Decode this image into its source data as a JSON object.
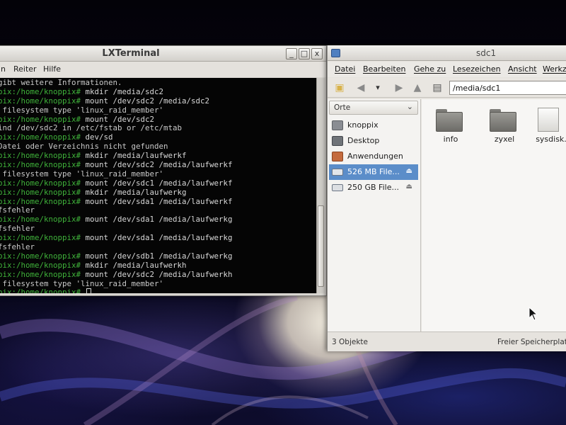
{
  "terminal": {
    "title": "LXTerminal",
    "menu": [
      "n",
      "Reiter",
      "Hilfe"
    ],
    "window_buttons": [
      "_",
      "□",
      "x"
    ],
    "lines": [
      {
        "prompt": "",
        "text": "gibt weitere Informationen.",
        "kind": "out"
      },
      {
        "prompt": "pix:/home/knoppix#",
        "text": " mkdir /media/sdc2",
        "kind": "cmd"
      },
      {
        "prompt": "pix:/home/knoppix#",
        "text": " mount /dev/sdc2 /media/sdc2",
        "kind": "cmd"
      },
      {
        "prompt": "",
        "text": " filesystem type 'linux_raid_member'",
        "kind": "out"
      },
      {
        "prompt": "pix:/home/knoppix#",
        "text": " mount /dev/sdc2",
        "kind": "cmd"
      },
      {
        "prompt": "",
        "text": "ind /dev/sdc2 in /etc/fstab or /etc/mtab",
        "kind": "out"
      },
      {
        "prompt": "pix:/home/knoppix#",
        "text": " dev/sd",
        "kind": "cmd"
      },
      {
        "prompt": "",
        "text": "Datei oder Verzeichnis nicht gefunden",
        "kind": "out"
      },
      {
        "prompt": "pix:/home/knoppix#",
        "text": " mkdir /media/laufwerkf",
        "kind": "cmd"
      },
      {
        "prompt": "pix:/home/knoppix#",
        "text": " mount /dev/sdc2 /media/laufwerkf",
        "kind": "cmd"
      },
      {
        "prompt": "",
        "text": " filesystem type 'linux_raid_member'",
        "kind": "out"
      },
      {
        "prompt": "pix:/home/knoppix#",
        "text": " mount /dev/sdc1 /media/laufwerkf",
        "kind": "cmd"
      },
      {
        "prompt": "pix:/home/knoppix#",
        "text": " mkdir /media/laufwerkg",
        "kind": "cmd"
      },
      {
        "prompt": "pix:/home/knoppix#",
        "text": " mount /dev/sda1 /media/laufwerkf",
        "kind": "cmd"
      },
      {
        "prompt": "",
        "text": "fsfehler",
        "kind": "out"
      },
      {
        "prompt": "pix:/home/knoppix#",
        "text": " mount /dev/sda1 /media/laufwerkg",
        "kind": "cmd"
      },
      {
        "prompt": "",
        "text": "fsfehler",
        "kind": "out"
      },
      {
        "prompt": "pix:/home/knoppix#",
        "text": " mount /dev/sda1 /media/laufwerkg",
        "kind": "cmd"
      },
      {
        "prompt": "",
        "text": "fsfehler",
        "kind": "out"
      },
      {
        "prompt": "pix:/home/knoppix#",
        "text": " mount /dev/sdb1 /media/laufwerkg",
        "kind": "cmd"
      },
      {
        "prompt": "pix:/home/knoppix#",
        "text": " mkdir /media/laufwerkh",
        "kind": "cmd"
      },
      {
        "prompt": "pix:/home/knoppix#",
        "text": " mount /dev/sdc2 /media/laufwerkh",
        "kind": "cmd"
      },
      {
        "prompt": "",
        "text": " filesystem type 'linux_raid_member'",
        "kind": "out"
      },
      {
        "prompt": "pix:/home/knoppix#",
        "text": " ",
        "kind": "cursor"
      }
    ]
  },
  "filemanager": {
    "title": "sdc1",
    "menu": [
      "Datei",
      "Bearbeiten",
      "Gehe zu",
      "Lesezeichen",
      "Ansicht",
      "Werkz"
    ],
    "path": "/media/sdc1",
    "sidebar_header": "Orte",
    "places": [
      {
        "label": "knoppix",
        "icon": "home-icon",
        "selected": false,
        "eject": false
      },
      {
        "label": "Desktop",
        "icon": "desktop-icon",
        "selected": false,
        "eject": false
      },
      {
        "label": "Anwendungen",
        "icon": "applications-icon",
        "selected": false,
        "eject": false
      },
      {
        "label": "526 MB File...",
        "icon": "drive-icon",
        "selected": true,
        "eject": true
      },
      {
        "label": "250 GB File...",
        "icon": "drive-icon",
        "selected": false,
        "eject": true
      }
    ],
    "files": [
      {
        "name": "info",
        "type": "folder"
      },
      {
        "name": "zyxel",
        "type": "folder"
      },
      {
        "name": "sysdisk.",
        "type": "file"
      }
    ],
    "status_left": "3 Objekte",
    "status_right": "Freier Speicherplat"
  },
  "colors": {
    "prompt": "#3fb23a",
    "selection": "#5b8dc9",
    "terminal_bg": "#050505"
  }
}
